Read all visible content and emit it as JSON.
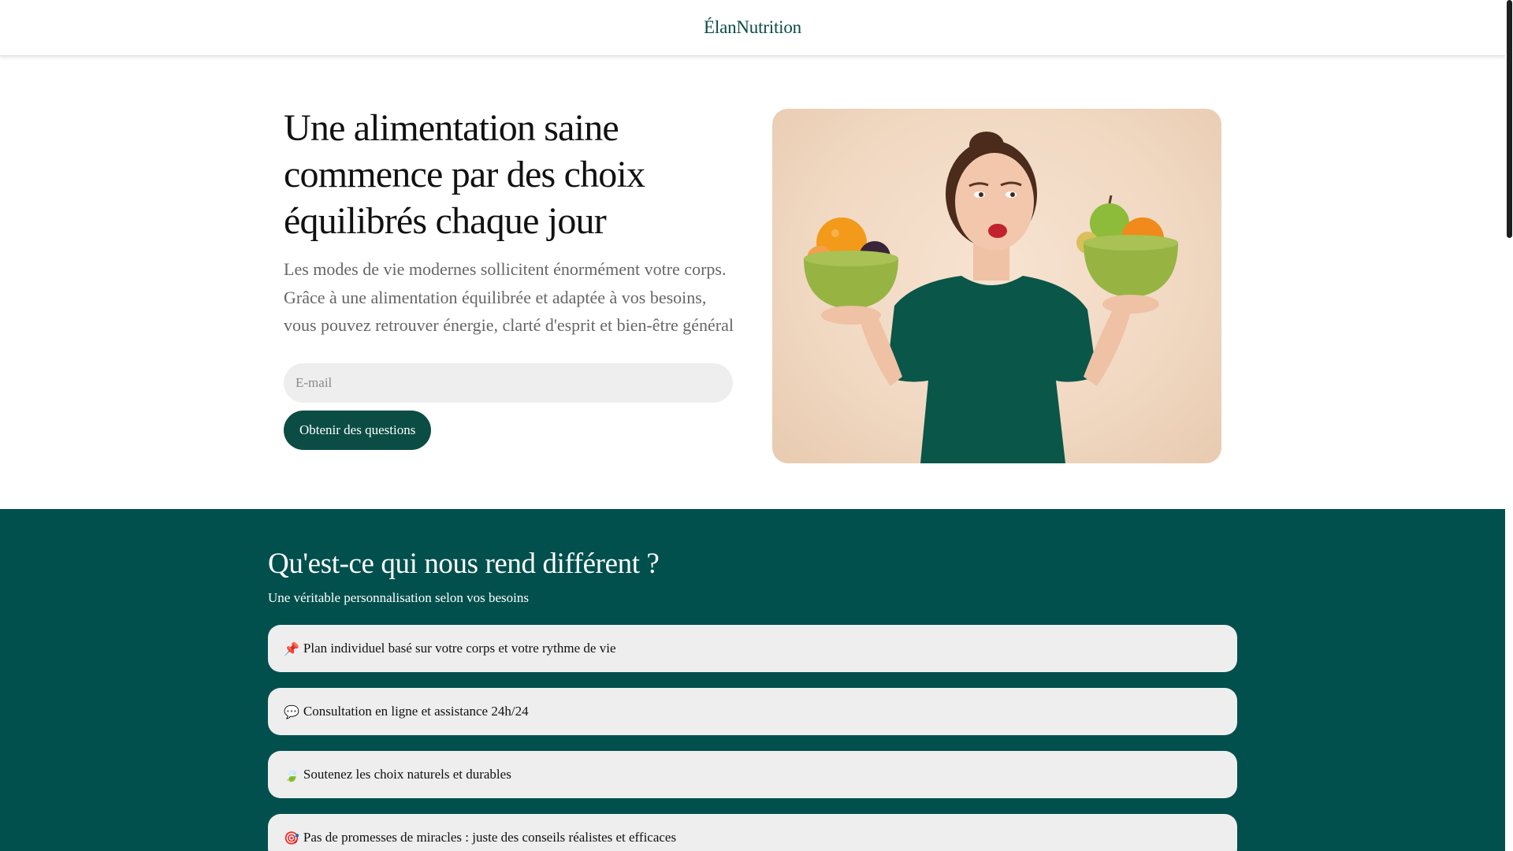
{
  "header": {
    "logo": "ÉlanNutrition"
  },
  "hero": {
    "title": "Une alimentation saine commence par des choix équilibrés chaque jour",
    "text": "Les modes de vie modernes sollicitent énormément votre corps. Grâce à une alimentation équilibrée et adaptée à vos besoins, vous pouvez retrouver énergie, clarté d'esprit et bien-être général",
    "email_placeholder": "E-mail",
    "email_value": "",
    "cta_label": "Obtenir des questions"
  },
  "features": {
    "title": "Qu'est-ce qui nous rend différent ?",
    "subtitle": "Une véritable personnalisation selon vos besoins",
    "items": [
      {
        "emoji": "📌",
        "icon": "pushpin-icon",
        "text": "Plan individuel basé sur votre corps et votre rythme de vie"
      },
      {
        "emoji": "💬",
        "icon": "speech-bubble-icon",
        "text": "Consultation en ligne et assistance 24h/24"
      },
      {
        "emoji": "🍃",
        "icon": "leaf-icon",
        "text": "Soutenez les choix naturels et durables"
      },
      {
        "emoji": "🎯",
        "icon": "target-icon",
        "text": "Pas de promesses de miracles : juste des conseils réalistes et efficaces"
      }
    ]
  },
  "colors": {
    "brand": "#0b4d45",
    "features_background": "#01504d",
    "input_background": "#eeeeee",
    "feature_card_background": "#eeeeee"
  }
}
